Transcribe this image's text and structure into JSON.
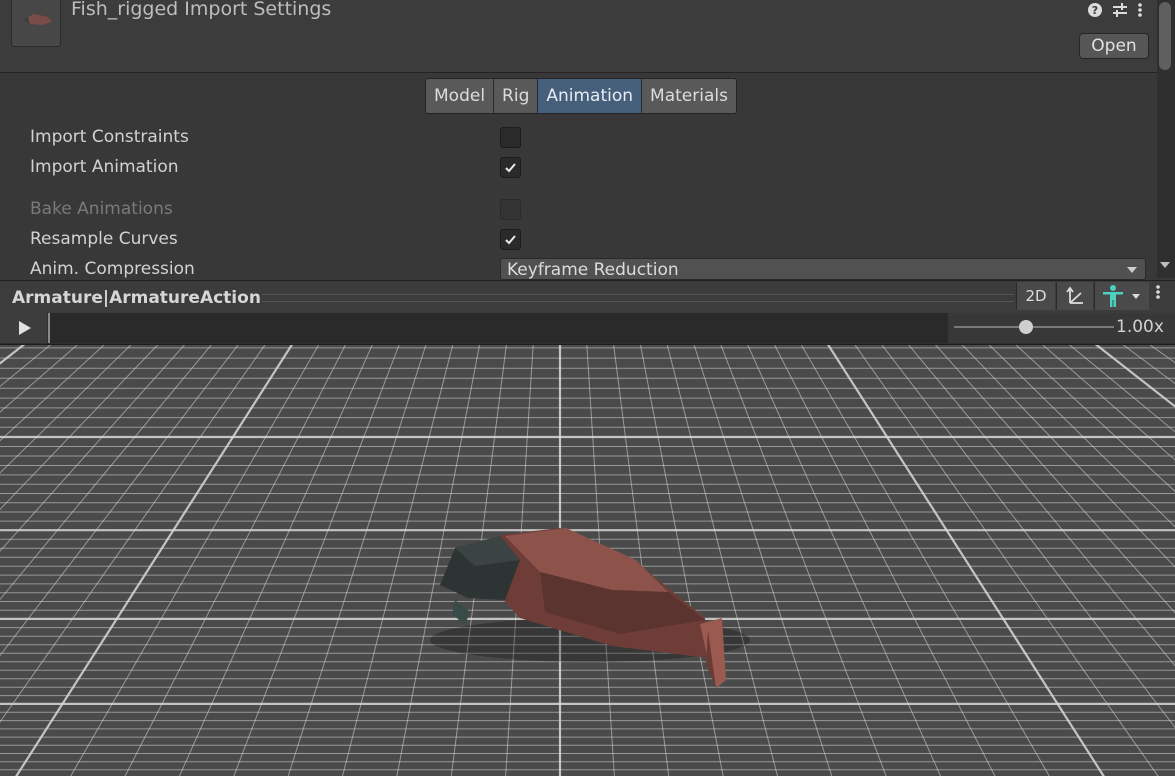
{
  "header": {
    "title": "Fish_rigged Import Settings",
    "open_label": "Open",
    "icons": [
      "help-icon",
      "presets-icon",
      "more-icon"
    ]
  },
  "tabs": [
    {
      "label": "Model",
      "active": false
    },
    {
      "label": "Rig",
      "active": false
    },
    {
      "label": "Animation",
      "active": true
    },
    {
      "label": "Materials",
      "active": false
    }
  ],
  "properties": {
    "import_constraints": {
      "label": "Import Constraints",
      "checked": false
    },
    "import_animation": {
      "label": "Import Animation",
      "checked": true
    },
    "bake_animations": {
      "label": "Bake Animations",
      "checked": false,
      "disabled": true
    },
    "resample_curves": {
      "label": "Resample Curves",
      "checked": true
    },
    "anim_compression": {
      "label": "Anim. Compression",
      "value": "Keyframe Reduction"
    }
  },
  "preview": {
    "clip_name": "Armature|ArmatureAction",
    "mode_2d": "2D",
    "speed": "1.00x",
    "speed_slider": 0.45
  },
  "colors": {
    "accent_tab": "#46607c",
    "fish_body": "#8a4a44",
    "grid_line": "#d8d8d8"
  }
}
